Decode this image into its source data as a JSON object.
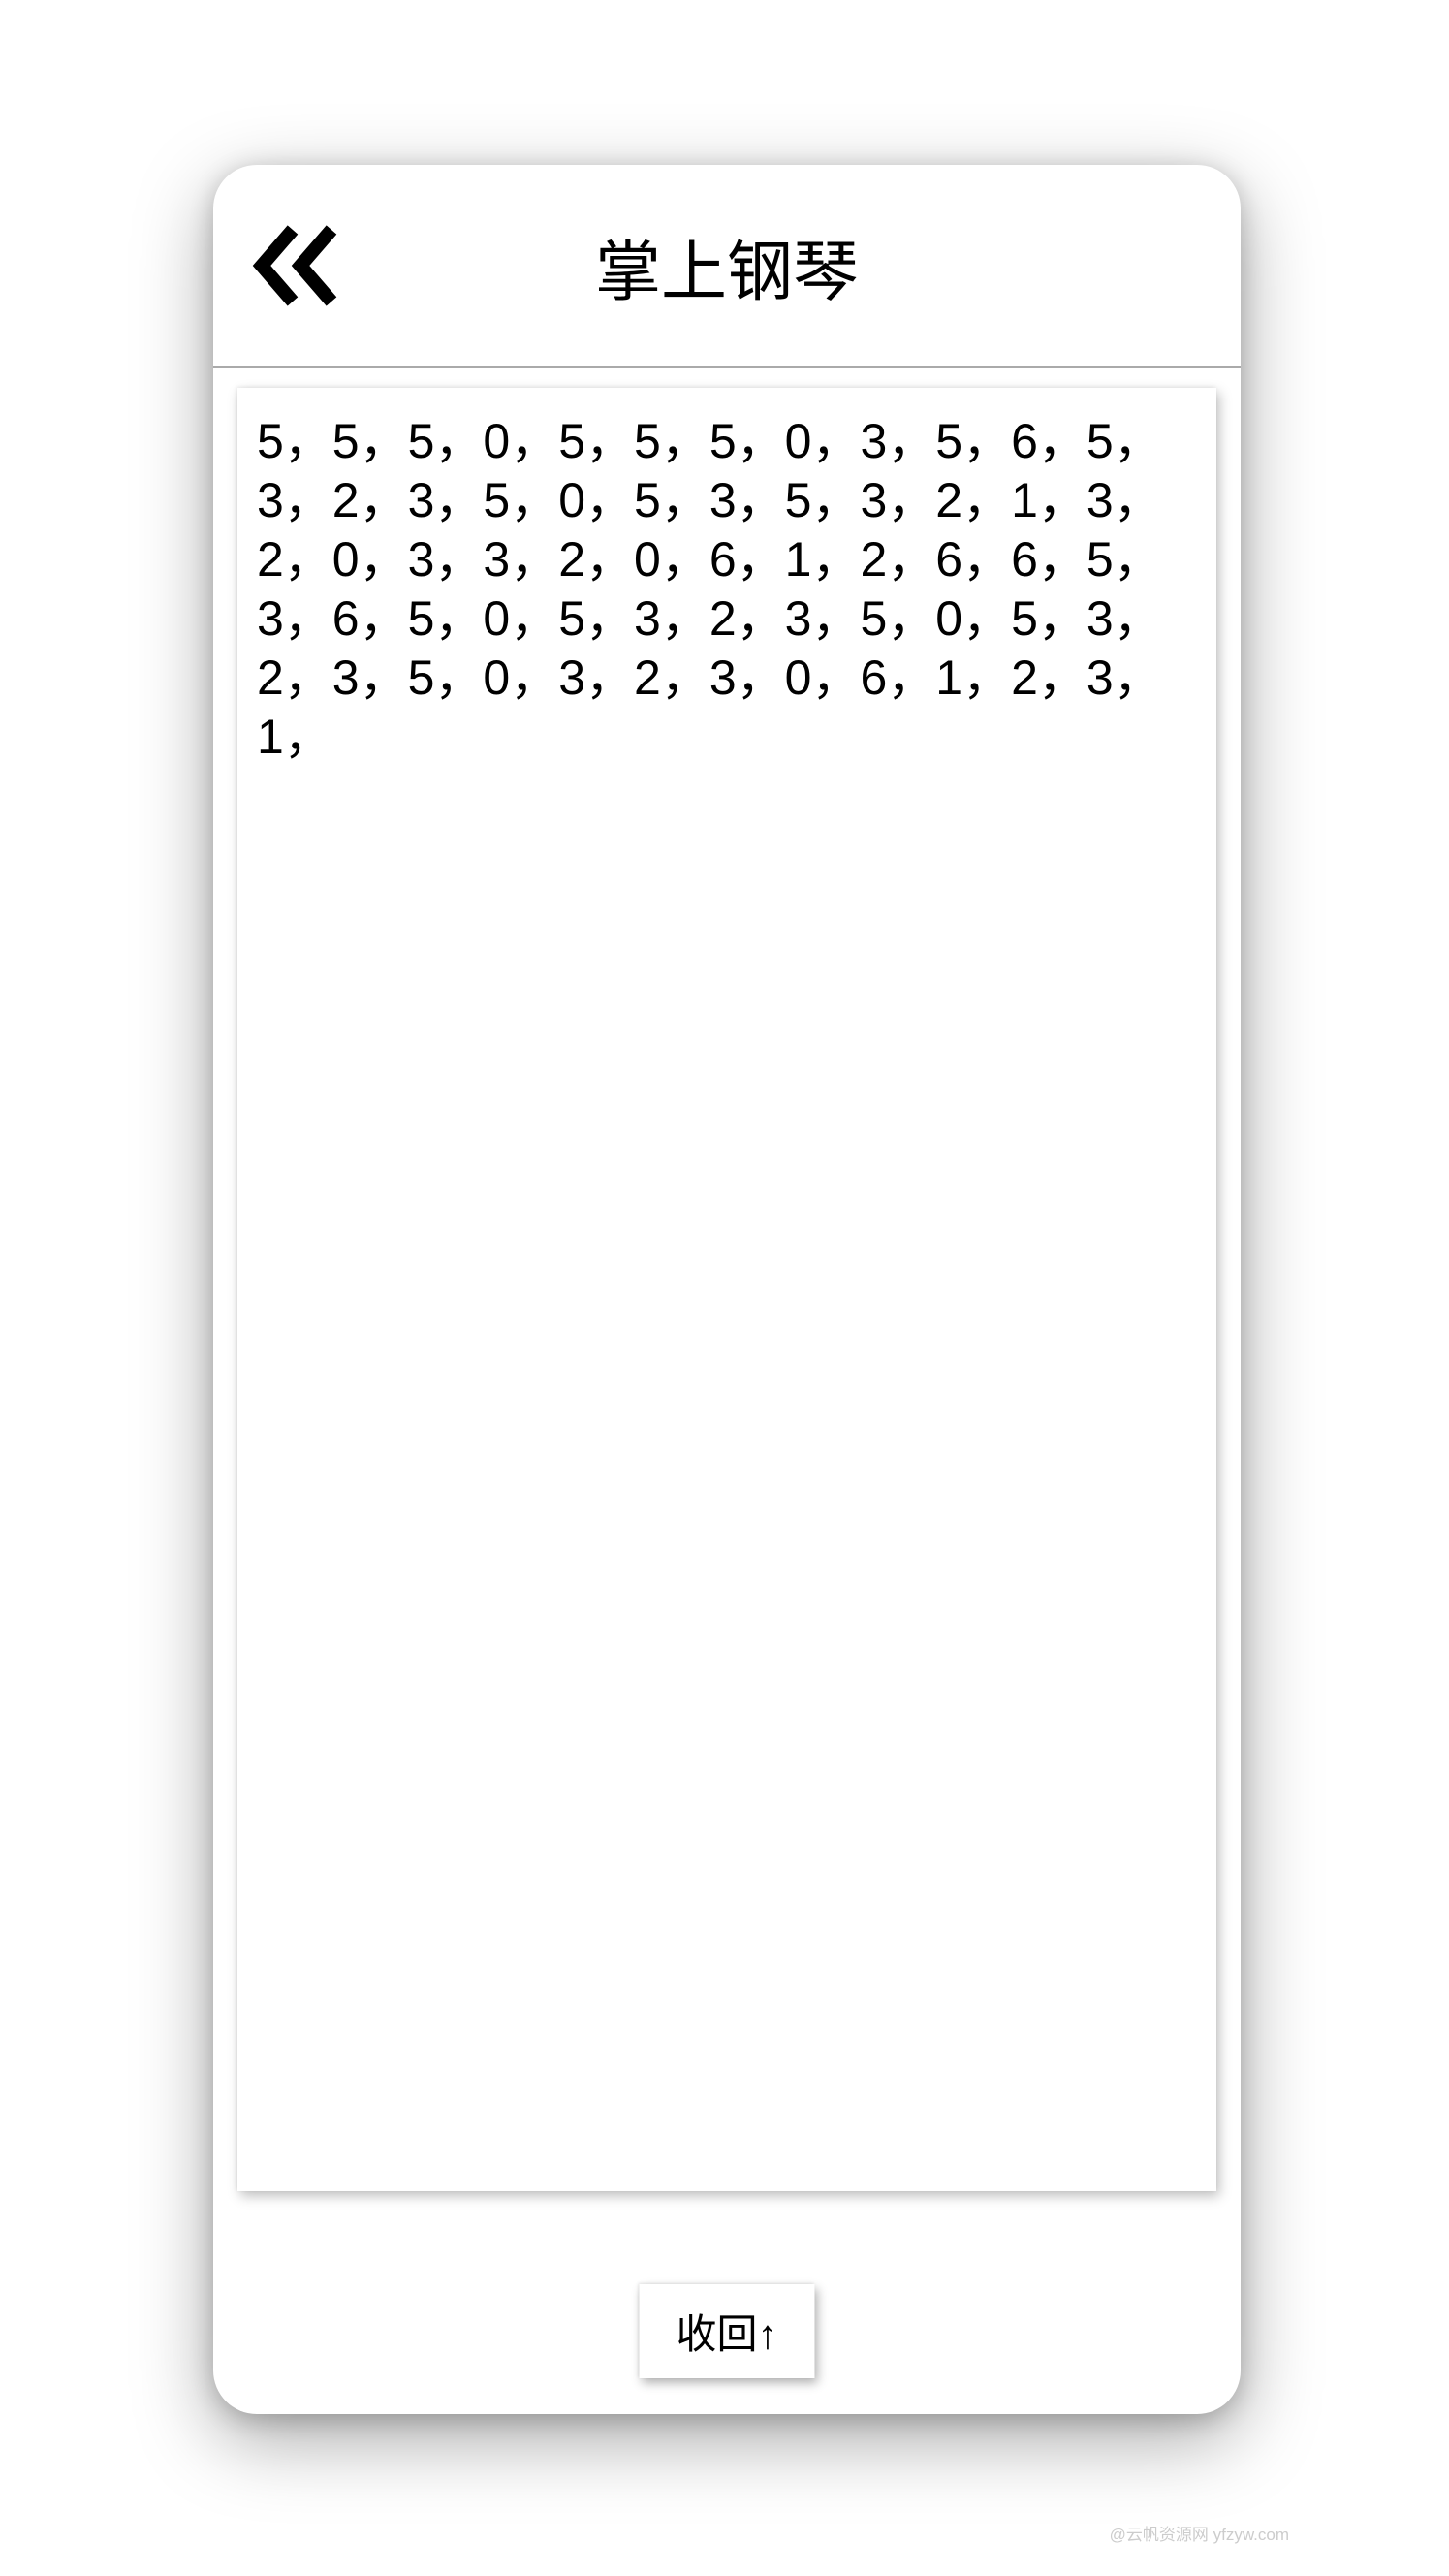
{
  "header": {
    "title": "掌上钢琴"
  },
  "content": {
    "notation": "5，5，5，0，5，5，5，0，3，5，6，5，3，2，3，5，0，5，3，5，3，2，1，3，2，0，3，3，2，0，6，1，2，6，6，5，3，6，5，0，5，3，2，3，5，0，5，3，2，3，5，0，3，2，3，0，6，1，2，3，1，"
  },
  "footer": {
    "collapse_label": "收回↑"
  },
  "watermark": "@云帆资源网 yfzyw.com"
}
